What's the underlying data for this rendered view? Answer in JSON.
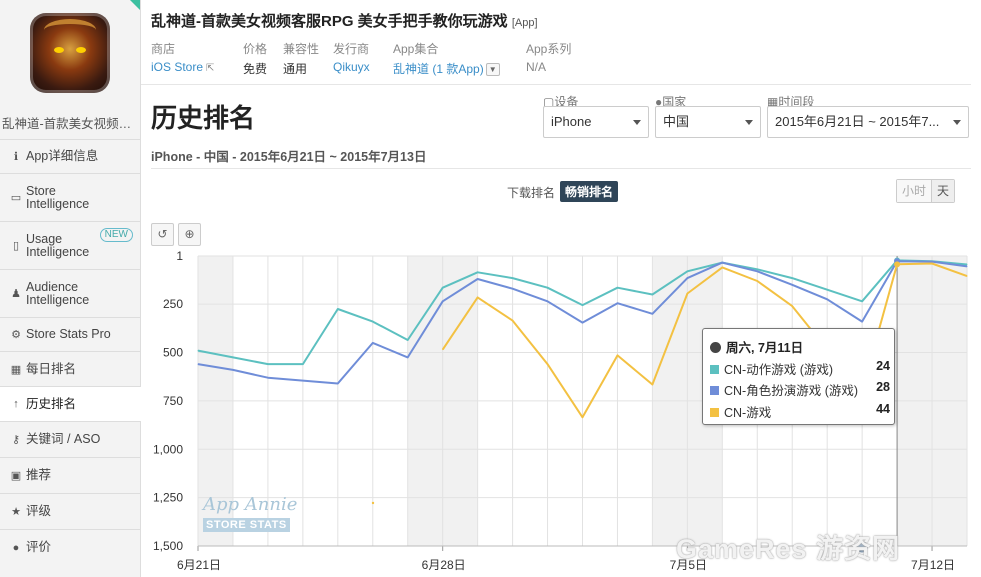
{
  "sidebar": {
    "app_name": "乱神道-首款美女视频客...",
    "items": [
      {
        "icon": "info-circle-icon",
        "glyph": "ℹ",
        "label": "App详细信息"
      },
      {
        "icon": "store-icon",
        "glyph": "▭",
        "label": "Store\nIntelligence"
      },
      {
        "icon": "usage-icon",
        "glyph": "▯",
        "label": "Usage\nIntelligence",
        "badge": "NEW"
      },
      {
        "icon": "person-icon",
        "glyph": "♟",
        "label": "Audience\nIntelligence"
      },
      {
        "icon": "gear-icon",
        "glyph": "⚙",
        "label": "Store Stats Pro"
      },
      {
        "icon": "calendar-icon",
        "glyph": "▦",
        "label": "每日排名"
      },
      {
        "icon": "arrow-up-icon",
        "glyph": "↑",
        "label": "历史排名",
        "active": true
      },
      {
        "icon": "key-icon",
        "glyph": "⚷",
        "label": "关键词 / ASO"
      },
      {
        "icon": "feature-icon",
        "glyph": "▣",
        "label": "推荐"
      },
      {
        "icon": "star-icon",
        "glyph": "★",
        "label": "评级"
      },
      {
        "icon": "comment-icon",
        "glyph": "●",
        "label": "评价"
      }
    ]
  },
  "header": {
    "title": "乱神道-首款美女视频客服RPG 美女手把手教你玩游戏",
    "tag": "[App]",
    "meta": [
      {
        "key": "商店",
        "value": "iOS Store"
      },
      {
        "key": "价格",
        "value": "免费"
      },
      {
        "key": "兼容性",
        "value": "通用"
      },
      {
        "key": "发行商",
        "value": "Qikuyx"
      },
      {
        "key": "App集合",
        "value": "乱神道 (1 款App)"
      },
      {
        "key": "App系列",
        "value": "N/A"
      }
    ]
  },
  "page_title": "历史排名",
  "filters": {
    "device_label": "设备",
    "device_value": "iPhone",
    "country_label": "国家",
    "country_value": "中国",
    "period_label": "时间段",
    "period_value": "2015年6月21日 ~ 2015年7..."
  },
  "subtitle": "iPhone - 中国 - 2015年6月21日 ~ 2015年7月13日",
  "rank_tabs": {
    "downloads": "下载排名",
    "grossing": "畅销排名"
  },
  "granularity": {
    "hour": "小时",
    "day": "天"
  },
  "tools": {
    "reset_glyph": "↺",
    "zoom_glyph": "⊕"
  },
  "tooltip": {
    "header": "周六, 7月11日",
    "rows": [
      {
        "name": "CN-动作游戏 (游戏)",
        "value": "24",
        "color": "#5cc0c0"
      },
      {
        "name": "CN-角色扮演游戏 (游戏)",
        "value": "28",
        "color": "#6f8dd8"
      },
      {
        "name": "CN-游戏",
        "value": "44",
        "color": "#f3c142"
      }
    ]
  },
  "watermarks": {
    "logo_line1": "App Annie",
    "logo_line2": "STORE STATS",
    "site": "GameRes 游资网"
  },
  "chart_data": {
    "type": "line",
    "x": [
      "6月21日",
      "6月22日",
      "6月23日",
      "6月24日",
      "6月25日",
      "6月26日",
      "6月27日",
      "6月28日",
      "6月29日",
      "6月30日",
      "7月1日",
      "7月2日",
      "7月3日",
      "7月4日",
      "7月5日",
      "7月6日",
      "7月7日",
      "7月8日",
      "7月9日",
      "7月10日",
      "7月11日",
      "7月12日",
      "7月13日"
    ],
    "x_tick_labels": [
      "6月21日",
      "6月28日",
      "7月5日",
      "7月12日"
    ],
    "y_tick_labels": [
      "1",
      "250",
      "500",
      "750",
      "1,000",
      "1,250",
      "1,500"
    ],
    "ylim": [
      1,
      1500
    ],
    "y_reversed": true,
    "weekend_shading": true,
    "series": [
      {
        "name": "CN-动作游戏 (游戏)",
        "color": "#5cc0c0",
        "values": [
          490,
          525,
          560,
          560,
          275,
          340,
          435,
          165,
          85,
          115,
          165,
          255,
          165,
          200,
          80,
          35,
          70,
          115,
          175,
          235,
          24,
          28,
          45
        ]
      },
      {
        "name": "CN-角色扮演游戏 (游戏)",
        "color": "#6f8dd8",
        "values": [
          560,
          590,
          630,
          645,
          660,
          450,
          525,
          235,
          120,
          170,
          235,
          345,
          245,
          300,
          115,
          35,
          80,
          150,
          225,
          340,
          28,
          30,
          55
        ]
      },
      {
        "name": "CN-游戏",
        "color": "#f3c142",
        "values": [
          null,
          null,
          null,
          null,
          null,
          null,
          null,
          485,
          215,
          335,
          560,
          835,
          515,
          665,
          195,
          60,
          130,
          260,
          485,
          695,
          44,
          40,
          105
        ]
      }
    ],
    "highlight_x": "7月11日"
  }
}
